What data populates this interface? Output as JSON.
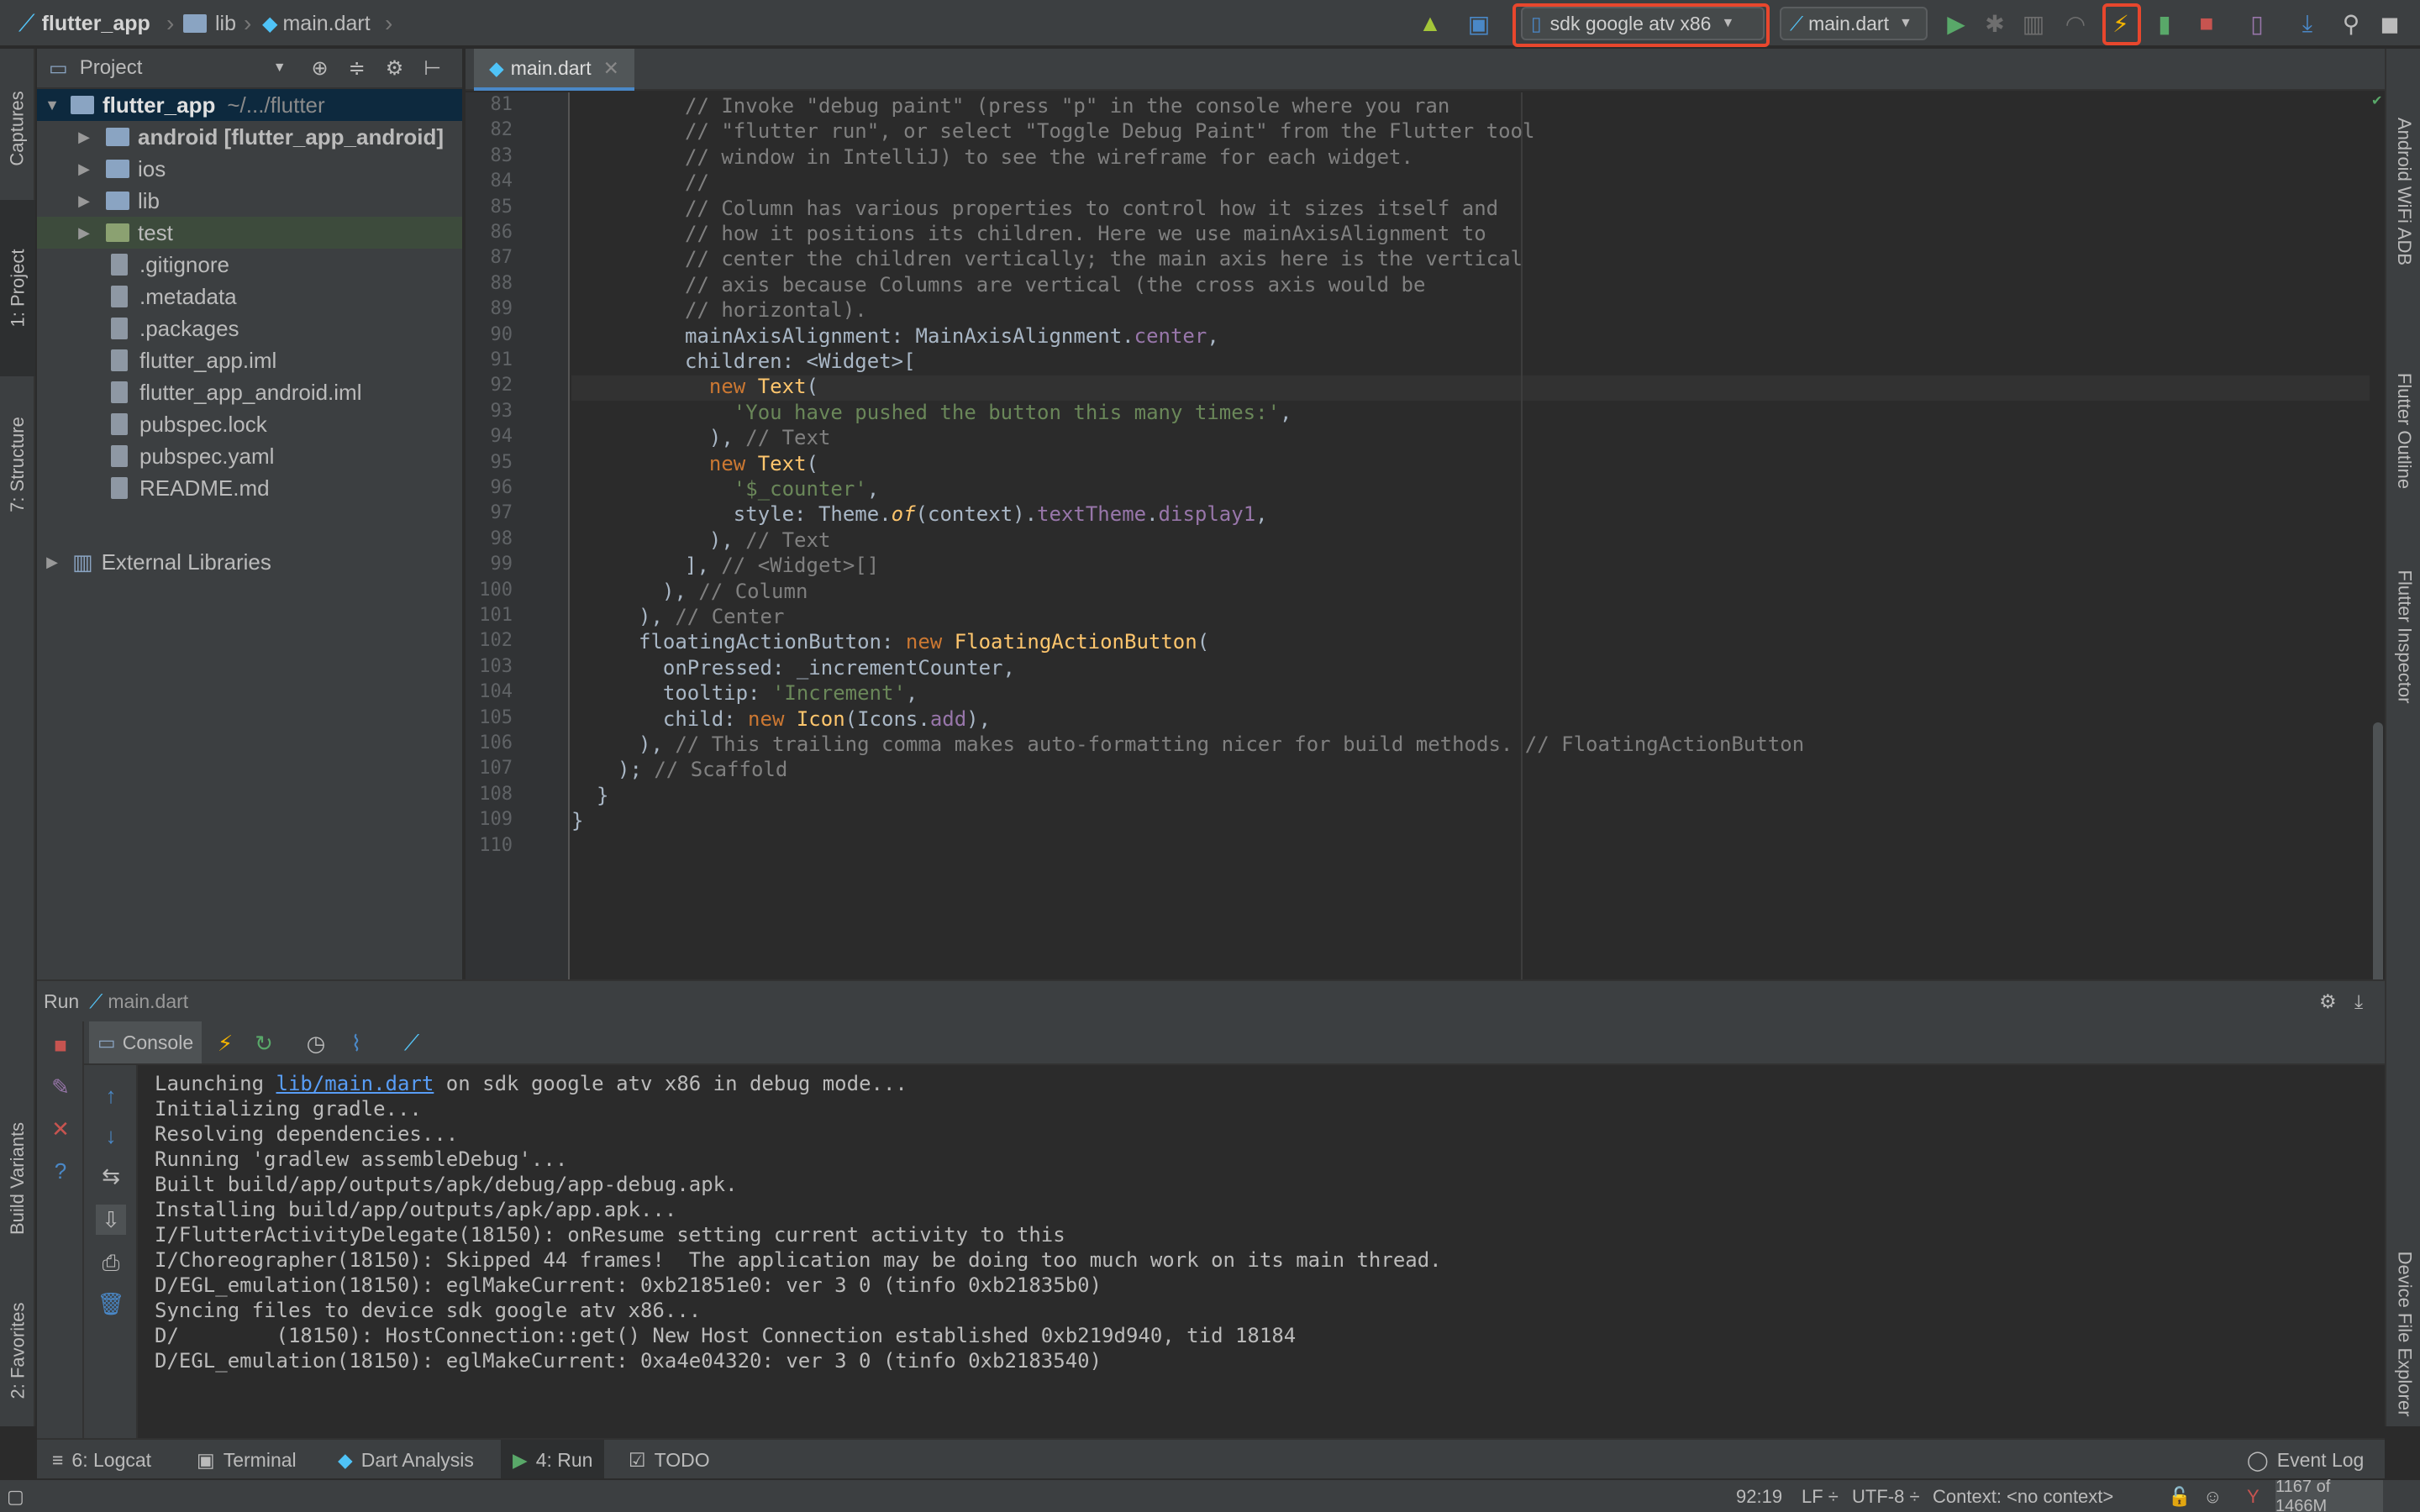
{
  "breadcrumb": {
    "project": "flutter_app",
    "folder": "lib",
    "file": "main.dart"
  },
  "toolbar": {
    "device_selector": "sdk google atv x86",
    "run_config": "main.dart",
    "icons": [
      "android-sync-icon",
      "translate-icon",
      "run-icon",
      "debug-icon",
      "profile-icon",
      "coverage-icon",
      "hot-reload-icon",
      "attach-icon",
      "stop-icon",
      "avd-manager-icon",
      "sdk-manager-icon",
      "search-icon",
      "user-icon"
    ],
    "highlight_color": "#e8472d"
  },
  "left_stripe": {
    "captures": "Captures",
    "project": "1: Project",
    "structure": "7: Structure",
    "build_variants": "Build Variants",
    "favorites": "2: Favorites"
  },
  "right_stripe": {
    "wifi_adb": "Android WiFi ADB",
    "flutter_outline": "Flutter Outline",
    "flutter_inspector": "Flutter Inspector",
    "device_file_explorer": "Device File Explorer"
  },
  "project_panel": {
    "title": "Project",
    "root_name": "flutter_app",
    "root_path": "~/.../flutter",
    "items": [
      {
        "name": "android [flutter_app_android]",
        "type": "module-folder"
      },
      {
        "name": "ios",
        "type": "folder"
      },
      {
        "name": "lib",
        "type": "folder"
      },
      {
        "name": "test",
        "type": "test-folder"
      },
      {
        "name": ".gitignore",
        "type": "file"
      },
      {
        "name": ".metadata",
        "type": "file"
      },
      {
        "name": ".packages",
        "type": "file"
      },
      {
        "name": "flutter_app.iml",
        "type": "file"
      },
      {
        "name": "flutter_app_android.iml",
        "type": "file"
      },
      {
        "name": "pubspec.lock",
        "type": "file"
      },
      {
        "name": "pubspec.yaml",
        "type": "file"
      },
      {
        "name": "README.md",
        "type": "file"
      }
    ],
    "external": "External Libraries"
  },
  "editor": {
    "tab": "main.dart",
    "current_line": "92",
    "lines": [
      {
        "n": "81",
        "html": "<span class=\"cm\">// Invoke \"debug paint\" (press \"p\" in the console where you ran</span>"
      },
      {
        "n": "82",
        "html": "<span class=\"cm\">// \"flutter run\", or select \"Toggle Debug Paint\" from the Flutter tool</span>"
      },
      {
        "n": "83",
        "html": "<span class=\"cm\">// window in IntelliJ) to see the wireframe for each widget.</span>"
      },
      {
        "n": "84",
        "html": "<span class=\"cm\">//</span>"
      },
      {
        "n": "85",
        "html": "<span class=\"cm\">// Column has various properties to control how it sizes itself and</span>"
      },
      {
        "n": "86",
        "html": "<span class=\"cm\">// how it positions its children. Here we use mainAxisAlignment to</span>"
      },
      {
        "n": "87",
        "html": "<span class=\"cm\">// center the children vertically; the main axis here is the vertical</span>"
      },
      {
        "n": "88",
        "html": "<span class=\"cm\">// axis because Columns are vertical (the cross axis would be</span>"
      },
      {
        "n": "89",
        "html": "<span class=\"cm\">// horizontal).</span>"
      },
      {
        "n": "90",
        "html": "mainAxisAlignment: MainAxisAlignment.<span class=\"fld\">center</span>,"
      },
      {
        "n": "91",
        "html": "children: &lt;Widget&gt;["
      },
      {
        "n": "92",
        "html": "  <span class=\"kw\">new</span> <span class=\"cls\">Text</span>("
      },
      {
        "n": "93",
        "html": "    <span class=\"st\">'You have pushed the button this many times:'</span>,"
      },
      {
        "n": "94",
        "html": "  ), <span class=\"cm\">// Text</span>"
      },
      {
        "n": "95",
        "html": "  <span class=\"kw\">new</span> <span class=\"cls\">Text</span>("
      },
      {
        "n": "96",
        "html": "    <span class=\"st\">'$_counter'</span>,"
      },
      {
        "n": "97",
        "html": "    style: Theme.<span class=\"fnc\">of</span>(context).<span class=\"fld\">textTheme</span>.<span class=\"fld\">display1</span>,"
      },
      {
        "n": "98",
        "html": "  ), <span class=\"cm\">// Text</span>"
      },
      {
        "n": "99",
        "html": "], <span class=\"cm\">// &lt;Widget&gt;[]</span>"
      },
      {
        "n": "100",
        "html": "), <span class=\"cm\">// Column</span>"
      },
      {
        "n": "101",
        "html": "), <span class=\"cm\">// Center</span>"
      },
      {
        "n": "102",
        "html": "floatingActionButton: <span class=\"kw\">new</span> <span class=\"cls\">FloatingActionButton</span>("
      },
      {
        "n": "103",
        "html": "  onPressed: _incrementCounter,"
      },
      {
        "n": "104",
        "html": "  tooltip: <span class=\"st\">'Increment'</span>,"
      },
      {
        "n": "105",
        "html": "  child: <span class=\"kw\">new</span> <span class=\"cls\">Icon</span>(Icons.<span class=\"fld\">add</span>),"
      },
      {
        "n": "106",
        "html": "), <span class=\"cm\">// This trailing comma makes auto-formatting nicer for build methods. // FloatingActionButton</span>"
      },
      {
        "n": "107",
        "html": "); <span class=\"cm\">// Scaffold</span>"
      },
      {
        "n": "108",
        "html": "}"
      },
      {
        "n": "109",
        "html": "}"
      },
      {
        "n": "110",
        "html": ""
      }
    ]
  },
  "run_panel": {
    "label": "Run",
    "config": "main.dart",
    "console_tab": "Console",
    "console_lines": [
      "Initializing gradle...",
      "Resolving dependencies...",
      "Running 'gradlew assembleDebug'...",
      "Built build/app/outputs/apk/debug/app-debug.apk.",
      "Installing build/app/outputs/apk/app.apk...",
      "I/FlutterActivityDelegate(18150): onResume setting current activity to this",
      "I/Choreographer(18150): Skipped 44 frames!  The application may be doing too much work on its main thread.",
      "D/EGL_emulation(18150): eglMakeCurrent: 0xb21851e0: ver 3 0 (tinfo 0xb21835b0)",
      "Syncing files to device sdk google atv x86...",
      "D/        (18150): HostConnection::get() New Host Connection established 0xb219d940, tid 18184",
      "D/EGL_emulation(18150): eglMakeCurrent: 0xa4e04320: ver 3 0 (tinfo 0xb2183540)"
    ],
    "launch_prefix": "Launching ",
    "launch_link": "lib/main.dart",
    "launch_suffix": " on sdk google atv x86 in debug mode..."
  },
  "bottom_tools": {
    "logcat": "6: Logcat",
    "terminal": "Terminal",
    "dart_analysis": "Dart Analysis",
    "run": "4: Run",
    "todo": "TODO",
    "event_log": "Event Log"
  },
  "status_bar": {
    "position": "92:19",
    "line_sep": "LF",
    "encoding": "UTF-8",
    "context": "Context: <no context>",
    "memory": "1167 of 1466M"
  }
}
